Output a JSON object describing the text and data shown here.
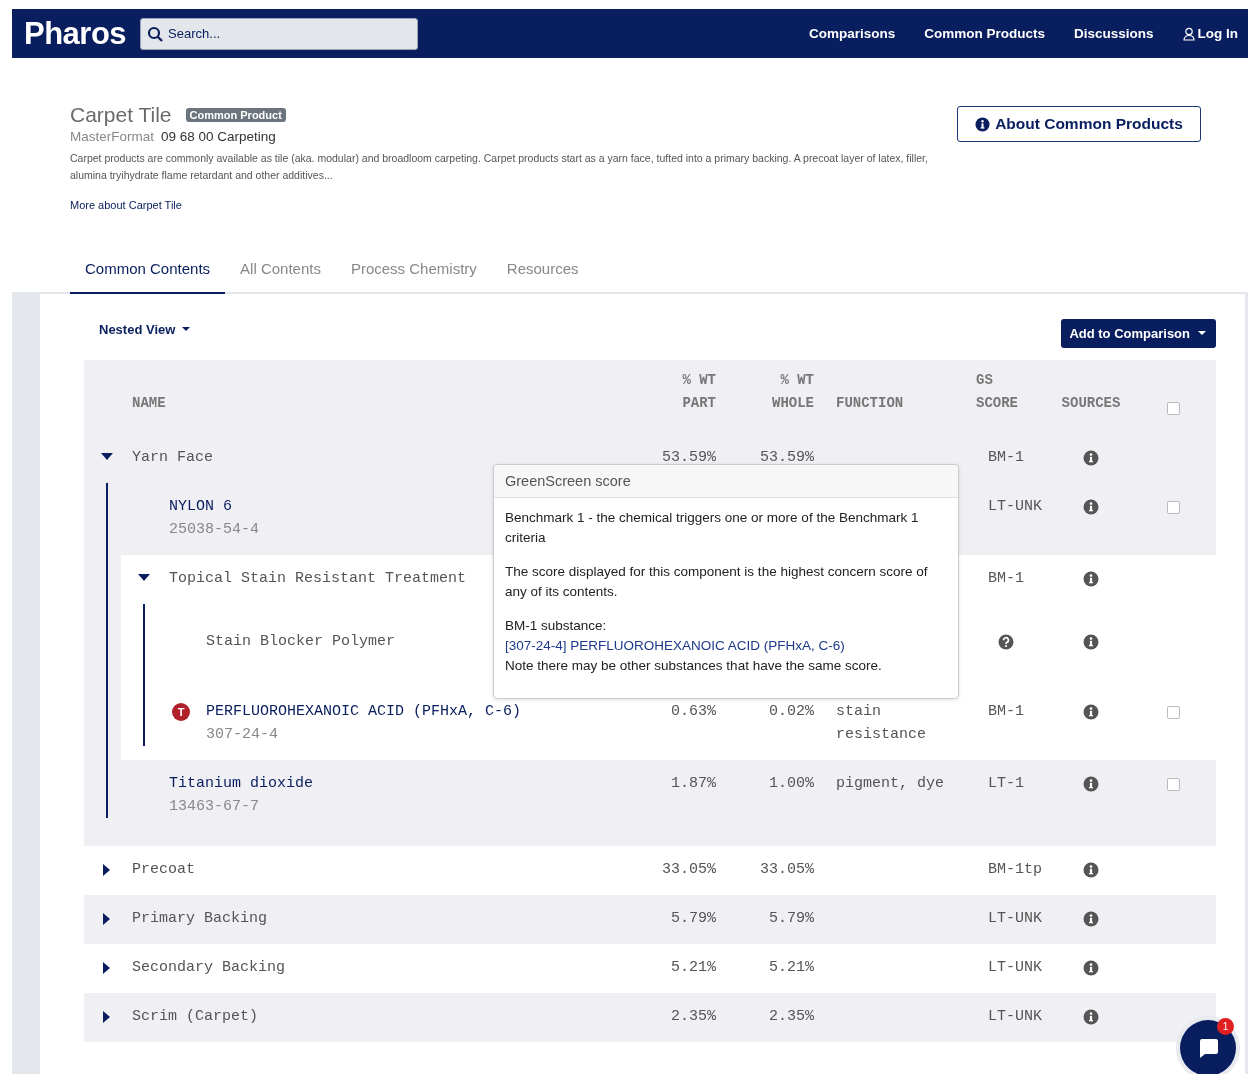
{
  "nav": {
    "logo": "Pharos",
    "search": {
      "placeholder": "Search..."
    },
    "links": [
      "Comparisons",
      "Common Products",
      "Discussions"
    ],
    "login": "Log In"
  },
  "product": {
    "title": "Carpet Tile",
    "badge": "Common Product",
    "classification_label": "MasterFormat",
    "classification": "09 68 00 Carpeting",
    "description": "Carpet products are commonly available as tile (aka. modular) and broadloom carpeting. Carpet products start as a yarn face, tufted into a primary backing. A precoat layer of latex, filler, alumina tryihydrate flame retardant and other additives...",
    "more_link": "More about Carpet Tile",
    "about_button": "About Common Products"
  },
  "tabs": [
    {
      "label": "Common Contents",
      "selected": true
    },
    {
      "label": "All Contents",
      "selected": false
    },
    {
      "label": "Process Chemistry",
      "selected": false
    },
    {
      "label": "Resources",
      "selected": false
    }
  ],
  "toolbar": {
    "view": "Nested View",
    "add_button": "Add to Comparison"
  },
  "table": {
    "columns": [
      {
        "lines": [
          "NAME"
        ]
      },
      {
        "lines": [
          "% WT",
          "PART"
        ]
      },
      {
        "lines": [
          "% WT",
          "WHOLE"
        ]
      },
      {
        "lines": [
          "FUNCTION"
        ]
      },
      {
        "lines": [
          "GS",
          "SCORE"
        ]
      },
      {
        "lines": [
          "SOURCES"
        ]
      }
    ],
    "header_checkbox": {
      "checked": false
    },
    "rows": [
      {
        "kind": "group",
        "name": "Yarn Face",
        "expanded": true,
        "part": "53.59%",
        "whole": "53.59%",
        "gs_score": "BM-1",
        "children": [
          {
            "kind": "substance",
            "name": "NYLON 6",
            "cas": "25038-54-4",
            "gs_score": "LT-UNK",
            "checkbox": {
              "checked": false
            }
          },
          {
            "kind": "group",
            "name": "Topical Stain Resistant Treatment",
            "expanded": true,
            "gs_score": "BM-1",
            "children": [
              {
                "kind": "material",
                "name": "Stain Blocker Polymer",
                "gs_unknown": true
              },
              {
                "kind": "substance",
                "name": "PERFLUOROHEXANOIC ACID (PFHxA, C-6)",
                "cas": "307-24-4",
                "hazard": "T",
                "part": "0.63%",
                "whole": "0.02%",
                "function": "stain resistance",
                "gs_score": "BM-1",
                "checkbox": {
                  "checked": false
                }
              }
            ]
          },
          {
            "kind": "substance",
            "name": "Titanium dioxide",
            "cas": "13463-67-7",
            "part": "1.87%",
            "whole": "1.00%",
            "function": "pigment, dye",
            "gs_score": "LT-1",
            "checkbox": {
              "checked": false
            }
          }
        ]
      },
      {
        "kind": "group",
        "name": "Precoat",
        "expanded": false,
        "part": "33.05%",
        "whole": "33.05%",
        "gs_score": "BM-1tp"
      },
      {
        "kind": "group",
        "name": "Primary Backing",
        "expanded": false,
        "part": "5.79%",
        "whole": "5.79%",
        "gs_score": "LT-UNK"
      },
      {
        "kind": "group",
        "name": "Secondary Backing",
        "expanded": false,
        "part": "5.21%",
        "whole": "5.21%",
        "gs_score": "LT-UNK"
      },
      {
        "kind": "group",
        "name": "Scrim (Carpet)",
        "expanded": false,
        "part": "2.35%",
        "whole": "2.35%",
        "gs_score": "LT-UNK"
      }
    ]
  },
  "tooltip": {
    "title": "GreenScreen score",
    "paragraphs": [
      "Benchmark 1 - the chemical triggers one or more of the Benchmark 1 criteria",
      "The score displayed for this component is the highest concern score of any of its contents."
    ],
    "substance_label": "BM-1 substance:",
    "substance_link": "[307-24-4] PERFLUOROHEXANOIC ACID (PFHxA, C-6)",
    "note": "Note there may be other substances that have the same score."
  },
  "chat": {
    "badge": "1"
  }
}
